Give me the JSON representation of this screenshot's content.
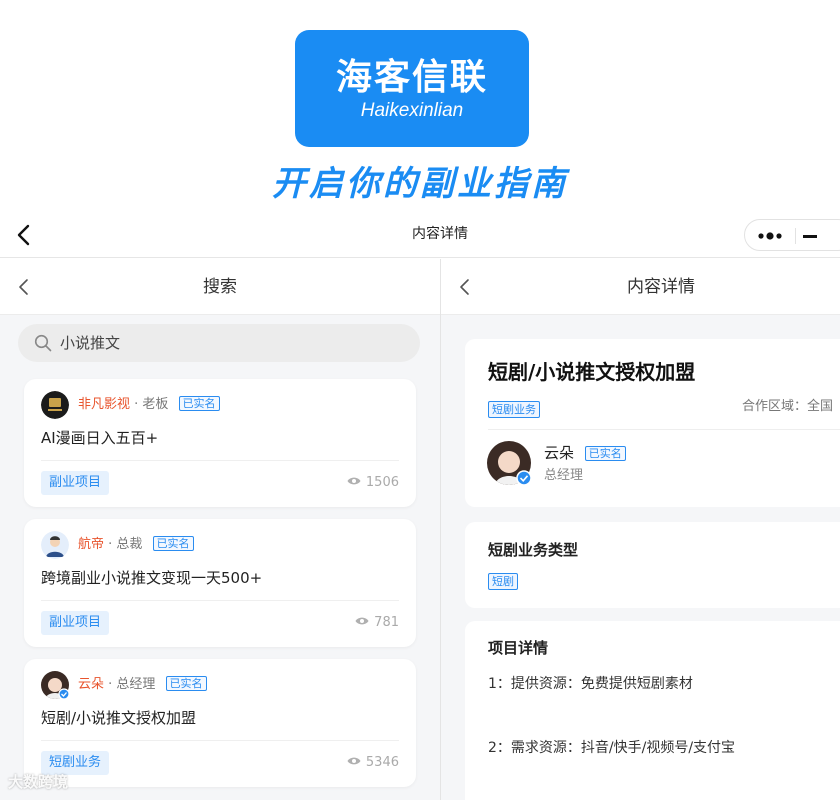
{
  "banner": {
    "logo_cn": "海客信联",
    "logo_en": "Haikexinlian",
    "slogan": "开启你的副业指南",
    "brand_color": "#1a8cf3"
  },
  "nav": {
    "title": "内容详情",
    "back_icon": "chevron-left-icon",
    "more_icon": "more-dots-icon",
    "minimize_icon": "minimize-icon"
  },
  "left_pane": {
    "title": "搜索",
    "search": {
      "value": "小说推文",
      "icon": "search-icon"
    },
    "results": [
      {
        "name": "非凡影视",
        "role": "· 老板",
        "badge": "已实名",
        "title": "AI漫画日入五百+",
        "tag": "副业项目",
        "views": "1506"
      },
      {
        "name": "航帝",
        "role": "· 总裁",
        "badge": "已实名",
        "title": "跨境副业小说推文变现一天500+",
        "tag": "副业项目",
        "views": "781"
      },
      {
        "name": "云朵",
        "role": "· 总经理",
        "badge": "已实名",
        "title": "短剧/小说推文授权加盟",
        "tag": "短剧业务",
        "views": "5346"
      }
    ]
  },
  "right_pane": {
    "title": "内容详情",
    "detail": {
      "title": "短剧/小说推文授权加盟",
      "category_tag": "短剧业务",
      "area_label": "合作区域：",
      "area_value": "全国",
      "person_name": "云朵",
      "person_badge": "已实名",
      "person_role": "总经理"
    },
    "type_section": {
      "title": "短剧业务类型",
      "tag": "短剧"
    },
    "detail_section": {
      "title": "项目详情",
      "lines": [
        "1：提供资源：免费提供短剧素材",
        "2：需求资源：抖音/快手/视频号/支付宝"
      ]
    }
  },
  "watermark": "大数跨境",
  "colors": {
    "accent": "#2a8cf0",
    "name_red": "#e8542d",
    "background": "#f5f6f8"
  }
}
